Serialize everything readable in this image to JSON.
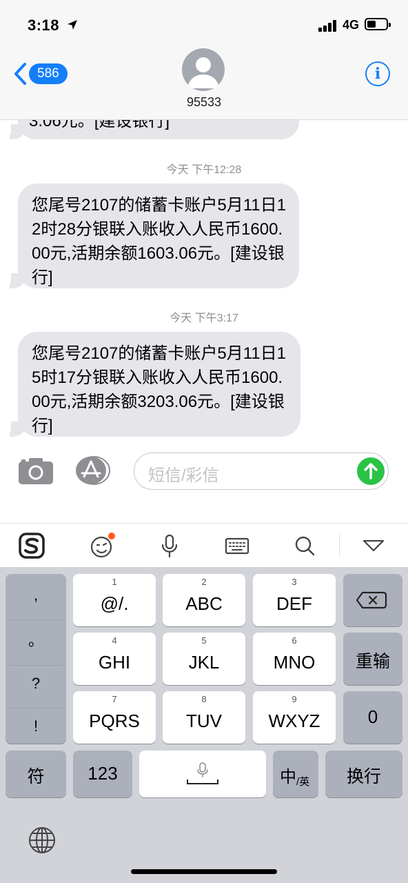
{
  "status_bar": {
    "time": "3:18",
    "network": "4G"
  },
  "header": {
    "back_count": "586",
    "contact": "95533"
  },
  "messages": {
    "partial_text": "3.06元。[建设银行]",
    "items": [
      {
        "timestamp": "今天 下午12:28",
        "text": "您尾号2107的储蓄卡账户5月11日12时28分银联入账收入人民币1600.00元,活期余额1603.06元。[建设银行]"
      },
      {
        "timestamp": "今天 下午3:17",
        "text": "您尾号2107的储蓄卡账户5月11日15时17分银联入账收入人民币1600.00元,活期余额3203.06元。[建设银行]"
      }
    ]
  },
  "input": {
    "placeholder": "短信/彩信"
  },
  "keyboard": {
    "punctuation": [
      ",",
      "。",
      "?",
      "!"
    ],
    "keys": {
      "k1": {
        "num": "1",
        "label": "@/."
      },
      "k2": {
        "num": "2",
        "label": "ABC"
      },
      "k3": {
        "num": "3",
        "label": "DEF"
      },
      "k4": {
        "num": "4",
        "label": "GHI"
      },
      "k5": {
        "num": "5",
        "label": "JKL"
      },
      "k6": {
        "num": "6",
        "label": "MNO"
      },
      "k7": {
        "num": "7",
        "label": "PQRS"
      },
      "k8": {
        "num": "8",
        "label": "TUV"
      },
      "k9": {
        "num": "9",
        "label": "WXYZ"
      }
    },
    "retype": "重输",
    "zero": "0",
    "symbols": "符",
    "numbers": "123",
    "lang_main": "中",
    "lang_sub": "/英",
    "enter": "换行"
  },
  "colors": {
    "accent": "#147efb",
    "bubble": "#e5e5ea",
    "send": "#2ac346",
    "keyboard_bg": "#d1d3d9"
  }
}
